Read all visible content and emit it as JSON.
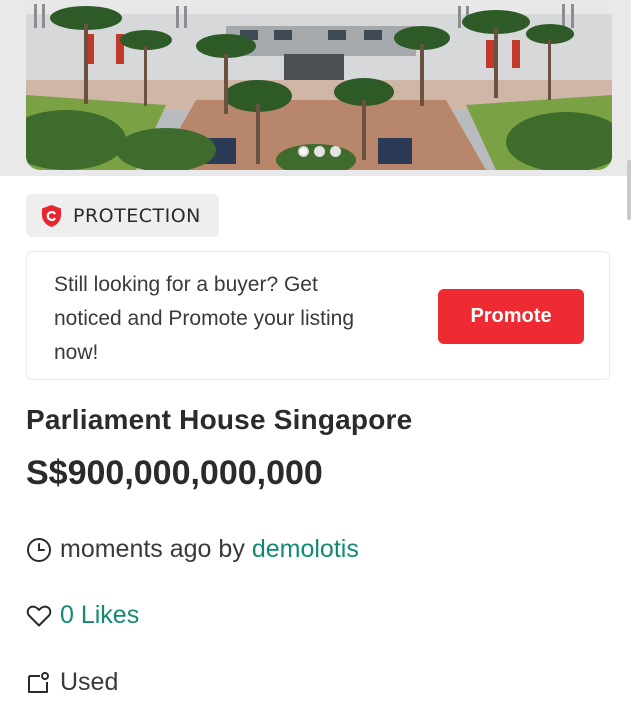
{
  "listing": {
    "gallery": {
      "slide_count": 3,
      "active_slide": 1
    },
    "protection_badge": "PROTECTION",
    "promo": {
      "text": "Still looking for a buyer? Get noticed and Promote your listing now!",
      "button_label": "Promote"
    },
    "title": "Parliament House Singapore",
    "price": "S$900,000,000,000",
    "posted": {
      "time": "moments ago by",
      "seller": "demolotis"
    },
    "likes": "0 Likes",
    "condition": "Used"
  },
  "colors": {
    "accent_red": "#ee2a32",
    "link_green": "#128a73",
    "badge_bg": "#eeeeee"
  },
  "icons": {
    "protection": "shield-c-icon",
    "time": "clock-icon",
    "likes": "heart-icon",
    "condition": "tag-icon"
  }
}
